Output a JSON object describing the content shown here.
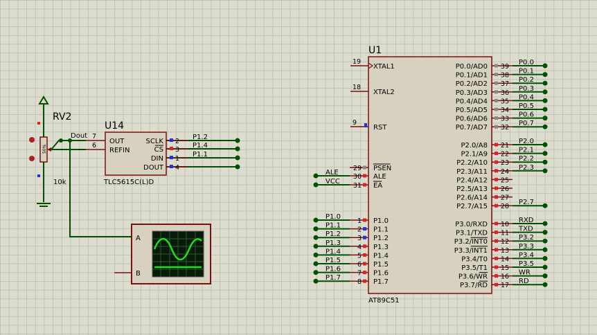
{
  "rv2": {
    "ref": "RV2",
    "value": "10k",
    "wiper": "50%"
  },
  "u14": {
    "ref": "U14",
    "part": "TLC5615C(L)D",
    "left_pins": [
      {
        "num": "7",
        "name": "OUT"
      },
      {
        "num": "6",
        "name": "REFIN"
      }
    ],
    "right_pins": [
      {
        "num": "2",
        "name": "SCLK",
        "net": "P1.2"
      },
      {
        "num": "3",
        "name": "CS",
        "net": "P1.4"
      },
      {
        "num": "1",
        "name": "DIN",
        "net": "P1.1"
      },
      {
        "num": "4",
        "name": "DOUT",
        "net": ""
      }
    ],
    "dout_net": "Dout"
  },
  "scope": {
    "channel_a": "A",
    "channel_b": "B"
  },
  "u1": {
    "ref": "U1",
    "part": "AT89C51",
    "left_top": [
      {
        "num": "19",
        "name": "XTAL1"
      },
      {
        "num": "18",
        "name": "XTAL2"
      },
      {
        "num": "9",
        "name": "RST"
      }
    ],
    "left_mid": [
      {
        "num": "29",
        "name": "PSEN",
        "net": ""
      },
      {
        "num": "30",
        "name": "ALE",
        "net": "ALE"
      },
      {
        "num": "31",
        "name": "EA",
        "net": "VCC"
      }
    ],
    "left_p1": [
      {
        "num": "1",
        "name": "P1.0",
        "net": "P1.0"
      },
      {
        "num": "2",
        "name": "P1.1",
        "net": "P1.1"
      },
      {
        "num": "3",
        "name": "P1.2",
        "net": "P1.2"
      },
      {
        "num": "4",
        "name": "P1.3",
        "net": "P1.3"
      },
      {
        "num": "5",
        "name": "P1.4",
        "net": "P1.4"
      },
      {
        "num": "6",
        "name": "P1.5",
        "net": "P1.5"
      },
      {
        "num": "7",
        "name": "P1.6",
        "net": "P1.6"
      },
      {
        "num": "8",
        "name": "P1.7",
        "net": "P1.7"
      }
    ],
    "right_p0": [
      {
        "num": "39",
        "name": "P0.0/AD0",
        "net": "P0.0"
      },
      {
        "num": "38",
        "name": "P0.1/AD1",
        "net": "P0.1"
      },
      {
        "num": "37",
        "name": "P0.2/AD2",
        "net": "P0.2"
      },
      {
        "num": "36",
        "name": "P0.3/AD3",
        "net": "P0.3"
      },
      {
        "num": "35",
        "name": "P0.4/AD4",
        "net": "P0.4"
      },
      {
        "num": "34",
        "name": "P0.5/AD5",
        "net": "P0.5"
      },
      {
        "num": "33",
        "name": "P0.6/AD6",
        "net": "P0.6"
      },
      {
        "num": "32",
        "name": "P0.7/AD7",
        "net": "P0.7"
      }
    ],
    "right_p2": [
      {
        "num": "21",
        "name": "P2.0/A8",
        "net": "P2.0"
      },
      {
        "num": "22",
        "name": "P2.1/A9",
        "net": "P2.1"
      },
      {
        "num": "23",
        "name": "P2.2/A10",
        "net": "P2.2"
      },
      {
        "num": "24",
        "name": "P2.3/A11",
        "net": "P2.3"
      },
      {
        "num": "25",
        "name": "P2.4/A12",
        "net": ""
      },
      {
        "num": "26",
        "name": "P2.5/A13",
        "net": ""
      },
      {
        "num": "27",
        "name": "P2.6/A14",
        "net": ""
      },
      {
        "num": "28",
        "name": "P2.7/A15",
        "net": "P2.7"
      }
    ],
    "right_p3": [
      {
        "num": "10",
        "name": "P3.0/RXD",
        "net": "RXD"
      },
      {
        "num": "11",
        "name": "P3.1/TXD",
        "net": "TXD"
      },
      {
        "num": "12",
        "name": "P3.2/INT0",
        "net": "P3.2"
      },
      {
        "num": "13",
        "name": "P3.3/INT1",
        "net": "P3.3"
      },
      {
        "num": "14",
        "name": "P3.4/T0",
        "net": "P3.4"
      },
      {
        "num": "15",
        "name": "P3.5/T1",
        "net": "P3.5"
      },
      {
        "num": "16",
        "name": "P3.6/WR",
        "net": "WR"
      },
      {
        "num": "17",
        "name": "P3.7/RD",
        "net": "RD"
      }
    ]
  },
  "colors": {
    "wire": "#005000",
    "body": "#d6d2bf",
    "outline": "#7a1010",
    "pin_red": "#dd2222",
    "pin_blue": "#2233dd",
    "pin_gray": "#888888"
  }
}
